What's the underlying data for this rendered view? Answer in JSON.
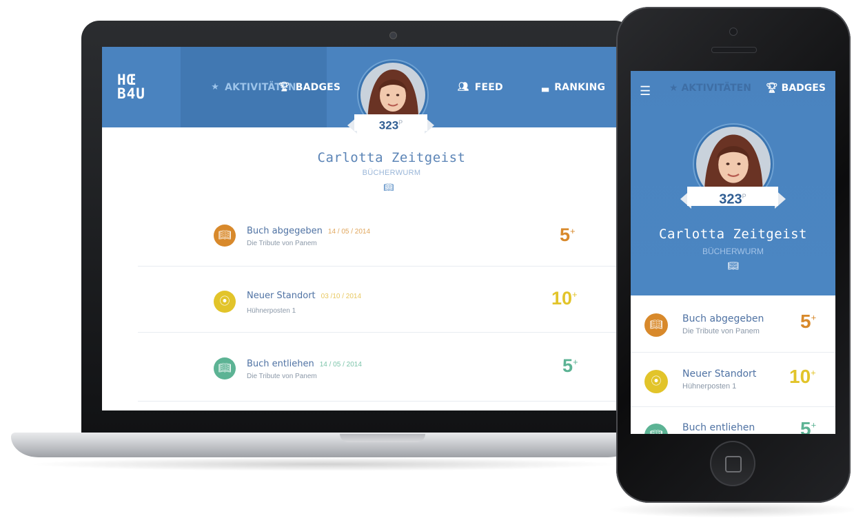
{
  "app": {
    "logo_line1": "HŒ",
    "logo_line2": "B4U"
  },
  "nav": {
    "activities": "AKTIVITÄTEN",
    "badges": "BADGES",
    "feed": "FEED",
    "ranking": "RANKING"
  },
  "profile": {
    "name": "Carlotta Zeitgeist",
    "rank": "BÜCHERWURM",
    "points": "323",
    "points_unit": "P"
  },
  "activities": [
    {
      "title": "Buch abgegeben",
      "date": "14 / 05 / 2014",
      "subtitle": "Die Tribute von Panem",
      "points": "5",
      "icon": "book-icon",
      "color": "#d8892b"
    },
    {
      "title": "Neuer Standort",
      "date": "03 /10 / 2014",
      "subtitle": "Hühnerposten 1",
      "points": "10",
      "icon": "location-pin-icon",
      "color": "#e2c42a"
    },
    {
      "title": "Buch entliehen",
      "date": "14 / 05 / 2014",
      "subtitle": "Die Tribute von Panem",
      "points": "5",
      "icon": "book-icon",
      "color": "#5cb394"
    }
  ],
  "colors": {
    "header_blue": "#4a83bf",
    "name_blue": "#5b84b6"
  },
  "plus": "+"
}
